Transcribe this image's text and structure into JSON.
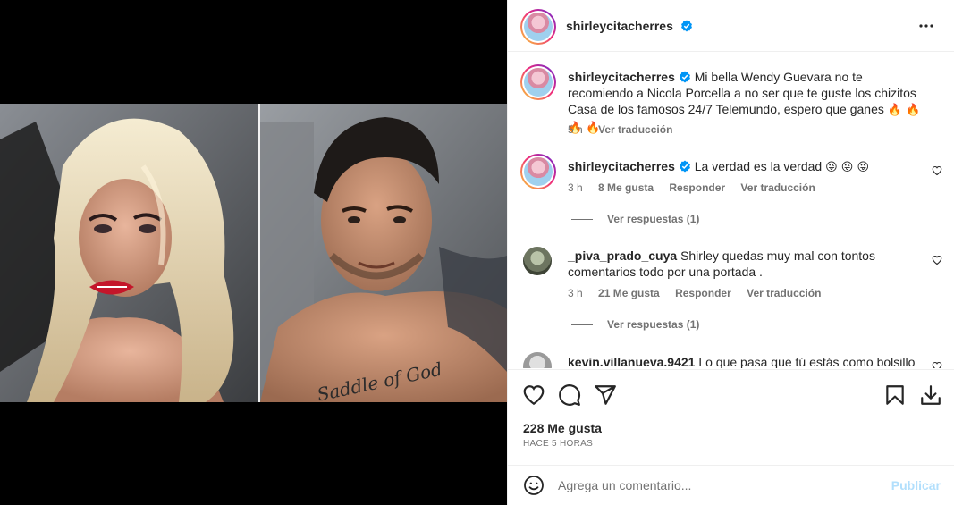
{
  "post": {
    "author": "shirleycitacherres",
    "caption": "Mi bella Wendy Guevara no te recomiendo a Nicola Porcella a no ser que te guste los chizitos Casa de los famosos 24/7 Telemundo, espero que ganes",
    "caption_emojis": "🔥 🔥 🔥 🔥",
    "caption_time": "5 h",
    "caption_translate": "Ver traducción",
    "photo_text": "Saddle of God"
  },
  "comments": [
    {
      "user": "shirleycitacherres",
      "text": "La verdad es la verdad",
      "emojis": "😜 😜 😜",
      "time": "3 h",
      "likes": "8 Me gusta",
      "reply": "Responder",
      "translate": "Ver traducción",
      "view_replies": "Ver respuestas (1)"
    },
    {
      "user": "_piva_prado_cuya",
      "text": "Shirley quedas muy mal con tontos comentarios todo por una portada .",
      "time": "3 h",
      "likes": "21 Me gusta",
      "reply": "Responder",
      "translate": "Ver traducción",
      "view_replies": "Ver respuestas (1)"
    },
    {
      "user": "kevin.villanueva.9421",
      "text": "Lo que pasa que tú estás como bolsillo"
    }
  ],
  "footer": {
    "likes": "228 Me gusta",
    "time_ago": "HACE 5 HORAS",
    "comment_placeholder": "Agrega un comentario...",
    "publish": "Publicar"
  },
  "colors": {
    "verified": "#0095f6",
    "publish_disabled": "#b2dffc",
    "secondary_text": "#737373"
  },
  "icons": [
    "more-options-icon",
    "heart-icon",
    "comment-icon",
    "share-icon",
    "bookmark-icon",
    "download-icon",
    "emoji-icon",
    "verified-icon"
  ]
}
